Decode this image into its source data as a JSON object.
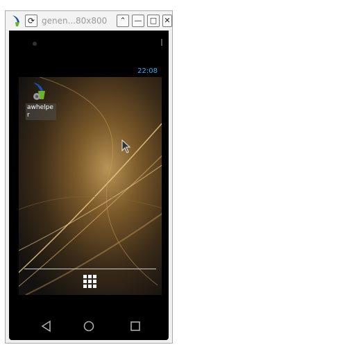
{
  "window": {
    "title": "genen...80x800",
    "reload_symbol": "⟳",
    "buttons": [
      {
        "name": "back-window-button",
        "symbol": "⌃"
      },
      {
        "name": "minimize-button",
        "symbol": "—"
      },
      {
        "name": "maximize-button",
        "symbol": "□"
      },
      {
        "name": "close-button",
        "symbol": "✕"
      }
    ]
  },
  "phone": {
    "status_time": "22:08",
    "desktop_icons": [
      {
        "label": "awhelper"
      }
    ],
    "nav": [
      "back-icon",
      "home-icon",
      "recents-icon"
    ]
  },
  "colors": {
    "clock": "#3fa9f5",
    "wallpaper_warm": "#b79457",
    "logo_blue": "#1f4fa8",
    "logo_green": "#6ab42a"
  }
}
